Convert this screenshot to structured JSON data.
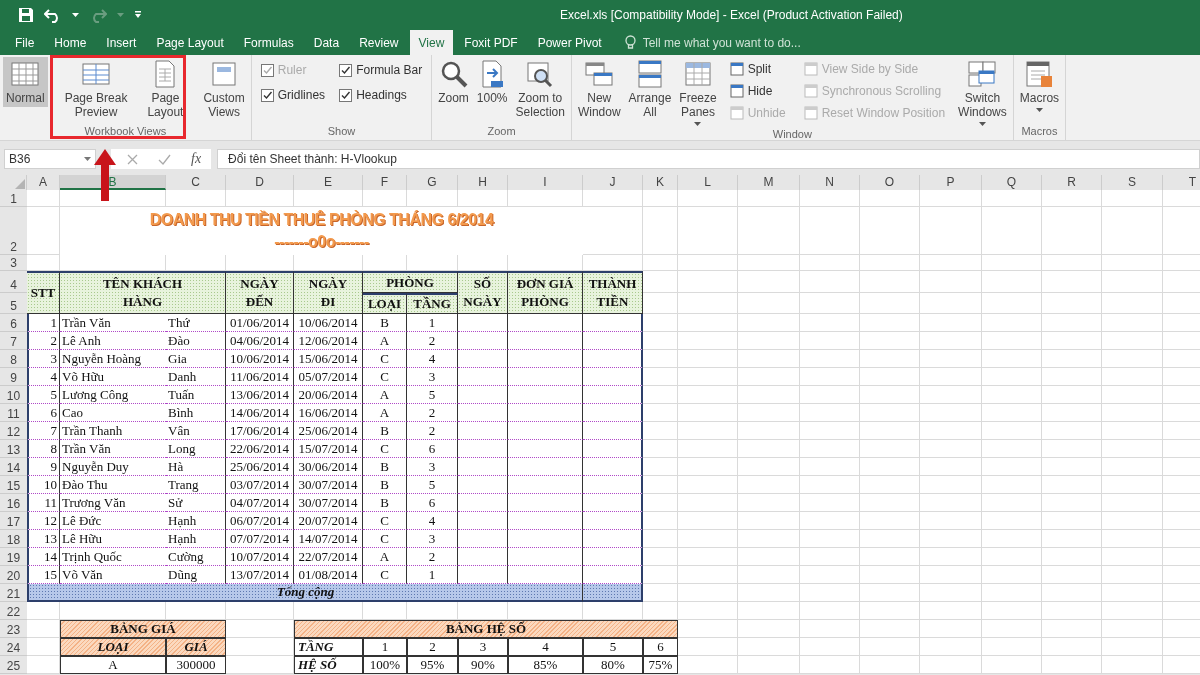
{
  "window": {
    "title": "Excel.xls  [Compatibility Mode] - Excel (Product Activation Failed)"
  },
  "tabs": [
    {
      "label": "File",
      "selected": false
    },
    {
      "label": "Home",
      "selected": false
    },
    {
      "label": "Insert",
      "selected": false
    },
    {
      "label": "Page Layout",
      "selected": false
    },
    {
      "label": "Formulas",
      "selected": false
    },
    {
      "label": "Data",
      "selected": false
    },
    {
      "label": "Review",
      "selected": false
    },
    {
      "label": "View",
      "selected": true
    },
    {
      "label": "Foxit PDF",
      "selected": false
    },
    {
      "label": "Power Pivot",
      "selected": false
    }
  ],
  "tell_me": {
    "placeholder": "Tell me what you want to do..."
  },
  "ribbon_groups": [
    {
      "label": "Workbook Views",
      "highlighted": true,
      "items": [
        {
          "kind": "large",
          "lines": [
            "Normal"
          ],
          "selected": true,
          "dropdown": false
        },
        {
          "kind": "large",
          "lines": [
            "Page Break",
            "Preview"
          ],
          "selected": false,
          "dropdown": false
        },
        {
          "kind": "large",
          "lines": [
            "Page",
            "Layout"
          ],
          "selected": false,
          "dropdown": false
        },
        {
          "kind": "large",
          "lines": [
            "Custom",
            "Views"
          ],
          "selected": false,
          "dropdown": false
        }
      ]
    },
    {
      "label": "Show",
      "highlighted": false,
      "items": [
        {
          "kind": "stack",
          "items": [
            {
              "kind": "check",
              "label": "Ruler",
              "checked": true,
              "disabled": true
            },
            {
              "kind": "check",
              "label": "Gridlines",
              "checked": true,
              "disabled": false
            }
          ]
        },
        {
          "kind": "stack",
          "items": [
            {
              "kind": "check",
              "label": "Formula Bar",
              "checked": true,
              "disabled": false
            },
            {
              "kind": "check",
              "label": "Headings",
              "checked": true,
              "disabled": false
            }
          ]
        }
      ]
    },
    {
      "label": "Zoom",
      "highlighted": false,
      "items": [
        {
          "kind": "large",
          "lines": [
            "Zoom"
          ],
          "selected": false,
          "dropdown": false
        },
        {
          "kind": "large",
          "lines": [
            "100%"
          ],
          "selected": false,
          "dropdown": false
        },
        {
          "kind": "large",
          "lines": [
            "Zoom to",
            "Selection"
          ],
          "selected": false,
          "dropdown": false
        }
      ]
    },
    {
      "label": "Window",
      "highlighted": false,
      "items": [
        {
          "kind": "large",
          "lines": [
            "New",
            "Window"
          ],
          "selected": false,
          "dropdown": false
        },
        {
          "kind": "large",
          "lines": [
            "Arrange",
            "All"
          ],
          "selected": false,
          "dropdown": false
        },
        {
          "kind": "large",
          "lines": [
            "Freeze",
            "Panes"
          ],
          "selected": false,
          "dropdown": true
        },
        {
          "kind": "stack",
          "items": [
            {
              "kind": "small",
              "label": "Split",
              "disabled": false
            },
            {
              "kind": "small",
              "label": "Hide",
              "disabled": false
            },
            {
              "kind": "small",
              "label": "Unhide",
              "disabled": true
            }
          ]
        },
        {
          "kind": "stack",
          "items": [
            {
              "kind": "small",
              "label": "View Side by Side",
              "disabled": true
            },
            {
              "kind": "small",
              "label": "Synchronous Scrolling",
              "disabled": true
            },
            {
              "kind": "small",
              "label": "Reset Window Position",
              "disabled": true
            }
          ]
        },
        {
          "kind": "large",
          "lines": [
            "Switch",
            "Windows"
          ],
          "selected": false,
          "dropdown": true
        }
      ]
    },
    {
      "label": "Macros",
      "highlighted": false,
      "items": [
        {
          "kind": "large",
          "lines": [
            "Macros"
          ],
          "selected": false,
          "dropdown": true
        }
      ]
    }
  ],
  "formula_bar": {
    "name_box": "B36",
    "function_label": "fx",
    "formula": "Đổi tên Sheet thành: H-Vlookup"
  },
  "columns": [
    {
      "label": "A",
      "selected": false
    },
    {
      "label": "B",
      "selected": true
    },
    {
      "label": "C",
      "selected": false
    },
    {
      "label": "D",
      "selected": false
    },
    {
      "label": "E",
      "selected": false
    },
    {
      "label": "F",
      "selected": false
    },
    {
      "label": "G",
      "selected": false
    },
    {
      "label": "H",
      "selected": false
    },
    {
      "label": "I",
      "selected": false
    },
    {
      "label": "J",
      "selected": false
    },
    {
      "label": "K",
      "selected": false
    },
    {
      "label": "L",
      "selected": false
    },
    {
      "label": "M",
      "selected": false
    },
    {
      "label": "N",
      "selected": false
    },
    {
      "label": "O",
      "selected": false
    },
    {
      "label": "P",
      "selected": false
    },
    {
      "label": "Q",
      "selected": false
    },
    {
      "label": "R",
      "selected": false
    },
    {
      "label": "S",
      "selected": false
    },
    {
      "label": "T",
      "selected": false
    }
  ],
  "row_numbers": [
    "1",
    "2",
    "3",
    "4",
    "5",
    "6",
    "7",
    "8",
    "9",
    "10",
    "11",
    "12",
    "13",
    "14",
    "15",
    "16",
    "17",
    "18",
    "19",
    "20",
    "21",
    "22",
    "23",
    "24",
    "25"
  ],
  "sheet_title": "DOANH THU TIỀN THUÊ PHÒNG THÁNG 6/2014",
  "sheet_subtitle": "-------o0o-------",
  "main_table": {
    "headers": {
      "stt": [
        "STT"
      ],
      "name": [
        "TÊN  KHÁCH",
        "HÀNG"
      ],
      "arrive": [
        "NGÀY",
        "ĐẾN"
      ],
      "leave": [
        "NGÀY",
        "ĐI"
      ],
      "room": [
        "PHÒNG"
      ],
      "type": [
        "LOẠI"
      ],
      "floor": [
        "TẦNG"
      ],
      "days": [
        "SỐ",
        "NGÀY"
      ],
      "price": [
        "ĐƠN GIÁ",
        "PHÒNG"
      ],
      "total": [
        "THÀNH",
        "TIỀN"
      ]
    },
    "rows": [
      {
        "stt": "1",
        "surname": "Trần Văn",
        "given": "Thứ",
        "arrive": "01/06/2014",
        "leave": "10/06/2014",
        "type": "B",
        "floor": "1"
      },
      {
        "stt": "2",
        "surname": "Lê Anh",
        "given": "Đào",
        "arrive": "04/06/2014",
        "leave": "12/06/2014",
        "type": "A",
        "floor": "2"
      },
      {
        "stt": "3",
        "surname": "Nguyễn Hoàng",
        "given": "Gia",
        "arrive": "10/06/2014",
        "leave": "15/06/2014",
        "type": "C",
        "floor": "4"
      },
      {
        "stt": "4",
        "surname": "Võ Hữu",
        "given": "Danh",
        "arrive": "11/06/2014",
        "leave": "05/07/2014",
        "type": "C",
        "floor": "3"
      },
      {
        "stt": "5",
        "surname": "Lương Công",
        "given": "Tuấn",
        "arrive": "13/06/2014",
        "leave": "20/06/2014",
        "type": "A",
        "floor": "5"
      },
      {
        "stt": "6",
        "surname": "Cao",
        "given": "Bình",
        "arrive": "14/06/2014",
        "leave": "16/06/2014",
        "type": "A",
        "floor": "2"
      },
      {
        "stt": "7",
        "surname": "Trần Thanh",
        "given": "Vân",
        "arrive": "17/06/2014",
        "leave": "25/06/2014",
        "type": "B",
        "floor": "2"
      },
      {
        "stt": "8",
        "surname": "Trần Văn",
        "given": "Long",
        "arrive": "22/06/2014",
        "leave": "15/07/2014",
        "type": "C",
        "floor": "6"
      },
      {
        "stt": "9",
        "surname": "Nguyễn Duy",
        "given": "Hà",
        "arrive": "25/06/2014",
        "leave": "30/06/2014",
        "type": "B",
        "floor": "3"
      },
      {
        "stt": "10",
        "surname": "Đào Thu",
        "given": "Trang",
        "arrive": "03/07/2014",
        "leave": "30/07/2014",
        "type": "B",
        "floor": "5"
      },
      {
        "stt": "11",
        "surname": "Trương Văn",
        "given": "Sử",
        "arrive": "04/07/2014",
        "leave": "30/07/2014",
        "type": "B",
        "floor": "6"
      },
      {
        "stt": "12",
        "surname": "Lê Đức",
        "given": "Hạnh",
        "arrive": "06/07/2014",
        "leave": "20/07/2014",
        "type": "C",
        "floor": "4"
      },
      {
        "stt": "13",
        "surname": "Lê Hữu",
        "given": "Hạnh",
        "arrive": "07/07/2014",
        "leave": "14/07/2014",
        "type": "C",
        "floor": "3"
      },
      {
        "stt": "14",
        "surname": "Trịnh Quốc",
        "given": "Cường",
        "arrive": "10/07/2014",
        "leave": "22/07/2014",
        "type": "A",
        "floor": "2"
      },
      {
        "stt": "15",
        "surname": "Võ Văn",
        "given": "Dũng",
        "arrive": "13/07/2014",
        "leave": "01/08/2014",
        "type": "C",
        "floor": "1"
      }
    ],
    "total_label": "Tổng cộng"
  },
  "price_table": {
    "title": "BẢNG GIÁ",
    "headers": [
      "LOẠI",
      "GIÁ"
    ],
    "rows": [
      [
        "A",
        "300000"
      ]
    ]
  },
  "coef_table": {
    "title": "BẢNG HỆ SỐ",
    "rows": [
      {
        "label": "TẦNG",
        "values": [
          "1",
          "2",
          "3",
          "4",
          "5",
          "6"
        ]
      },
      {
        "label": "HỆ SỐ",
        "values": [
          "100%",
          "95%",
          "90%",
          "85%",
          "80%",
          "75%"
        ]
      }
    ]
  }
}
